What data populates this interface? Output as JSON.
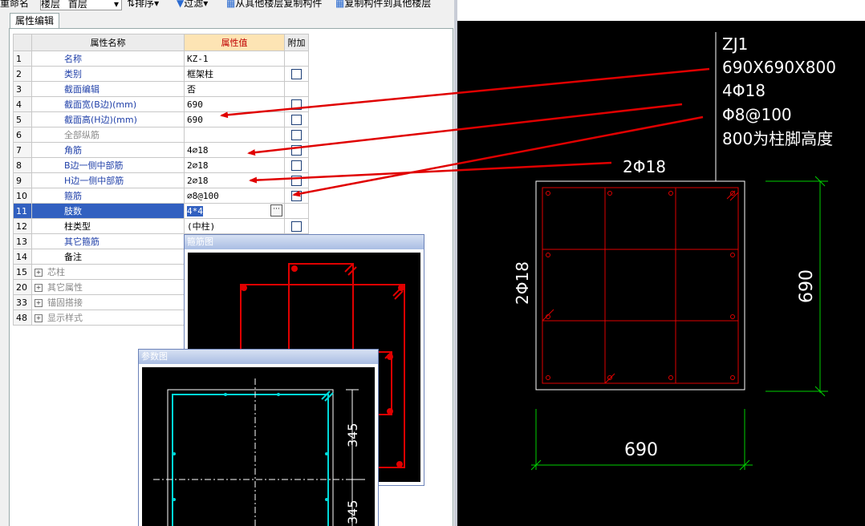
{
  "toolbar": {
    "rename": "重命名",
    "floor_label": "楼层",
    "floor_value": "首层",
    "sort": "排序",
    "filter": "过滤",
    "copy_from": "从其他楼层复制构件",
    "copy_to": "复制构件到其他楼层"
  },
  "tab": {
    "label": "属性编辑"
  },
  "table": {
    "headers": {
      "name": "属性名称",
      "value": "属性值",
      "extra": "附加"
    },
    "rows": [
      {
        "num": "1",
        "name": "名称",
        "value": "KZ-1",
        "check": false
      },
      {
        "num": "2",
        "name": "类别",
        "value": "框架柱",
        "check": true
      },
      {
        "num": "3",
        "name": "截面编辑",
        "value": "否",
        "check": false
      },
      {
        "num": "4",
        "name": "截面宽(B边)(mm)",
        "value": "690",
        "check": true
      },
      {
        "num": "5",
        "name": "截面高(H边)(mm)",
        "value": "690",
        "check": true
      },
      {
        "num": "6",
        "name": "全部纵筋",
        "value": "",
        "check": true
      },
      {
        "num": "7",
        "name": "角筋",
        "value": "4⌀18",
        "check": true
      },
      {
        "num": "8",
        "name": "B边一侧中部筋",
        "value": "2⌀18",
        "check": true
      },
      {
        "num": "9",
        "name": "H边一侧中部筋",
        "value": "2⌀18",
        "check": true
      },
      {
        "num": "10",
        "name": "箍筋",
        "value": "⌀8@100",
        "check": true
      },
      {
        "num": "11",
        "name": "肢数",
        "value": "4*4",
        "check": false
      },
      {
        "num": "12",
        "name": "柱类型",
        "value": "(中柱)",
        "check": true
      },
      {
        "num": "13",
        "name": "其它箍筋",
        "value": "",
        "check": false
      },
      {
        "num": "14",
        "name": "备注",
        "value": "",
        "check": false
      },
      {
        "num": "15",
        "name": "芯柱",
        "value": "",
        "check": false
      },
      {
        "num": "20",
        "name": "其它属性",
        "value": "",
        "check": false
      },
      {
        "num": "33",
        "name": "锚固搭接",
        "value": "",
        "check": false
      },
      {
        "num": "48",
        "name": "显示样式",
        "value": "",
        "check": false
      }
    ]
  },
  "stirrup_window": {
    "title": "箍筋图"
  },
  "param_window": {
    "title": "参数图",
    "dim1": "345",
    "dim2": "345"
  },
  "cad": {
    "note_lines": [
      "ZJ1",
      "690X690X800",
      "4Φ18",
      "Φ8@100",
      "800为柱脚高度"
    ],
    "side_bars": "2Φ18",
    "left_label": "2Φ18",
    "width_dim": "690",
    "height_dim": "690"
  },
  "colors": {
    "cad_bg": "#000000",
    "rebar": "#e00000",
    "dim": "#00d000",
    "text": "#ffffff",
    "arrow": "#e00000",
    "cyan": "#00d8d8"
  }
}
